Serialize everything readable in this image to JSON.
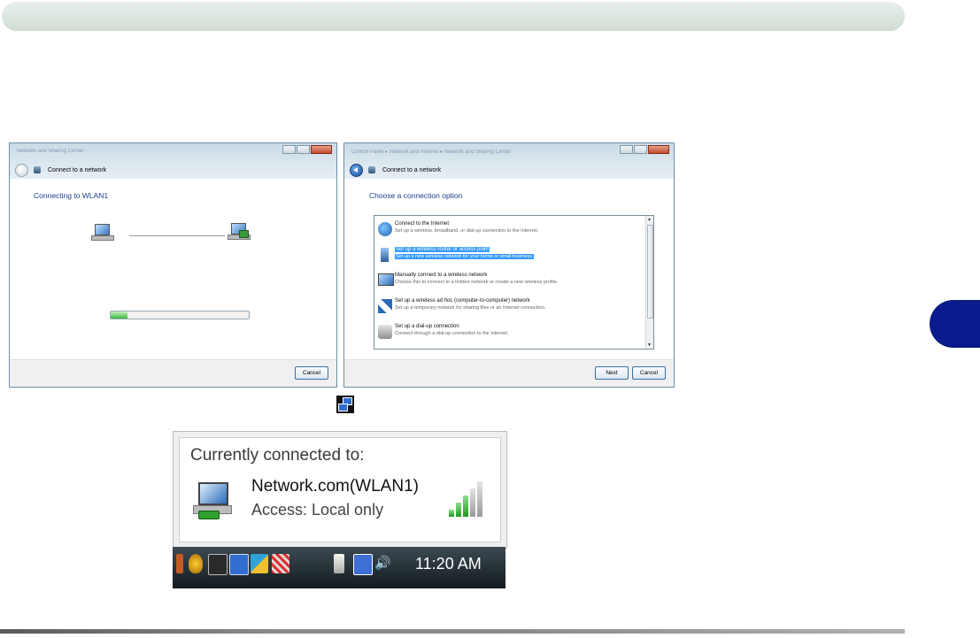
{
  "dialog1": {
    "breadcrumb": "Network and Sharing Center",
    "title": "Connect to a network",
    "heading": "Connecting to WLAN1",
    "progress": 0.12,
    "cancel": "Cancel"
  },
  "dialog2": {
    "breadcrumb": "Control Panel ▸ Network and Internet ▸ Network and Sharing Center",
    "title": "Connect to a network",
    "heading": "Choose a connection option",
    "options": [
      {
        "title": "Connect to the Internet",
        "desc": "Set up a wireless, broadband, or dial-up connection to the Internet."
      },
      {
        "title": "Set up a wireless router or access point",
        "desc": "Set up a new wireless network for your home or small business."
      },
      {
        "title": "Manually connect to a wireless network",
        "desc": "Choose this to connect to a hidden network or create a new wireless profile."
      },
      {
        "title": "Set up a wireless ad hoc (computer-to-computer) network",
        "desc": "Set up a temporary network for sharing files or an Internet connection."
      },
      {
        "title": "Set up a dial-up connection",
        "desc": "Connect through a dial-up connection to the Internet."
      }
    ],
    "next": "Next",
    "cancel": "Cancel"
  },
  "balloon": {
    "title": "Currently connected to:",
    "network": "Network.com(WLAN1)",
    "access": "Access:  Local only",
    "signal_bars": 5
  },
  "taskbar": {
    "clock": "11:20 AM"
  },
  "colors": {
    "chapter_tab": "#0b1a8c",
    "selection": "#3399ff",
    "dialog_heading": "#1b3f8c"
  }
}
